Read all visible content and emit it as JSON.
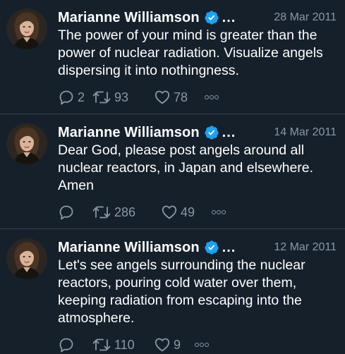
{
  "colors": {
    "background": "#15202b",
    "divider": "#38444d",
    "secondary_text": "#8899a6",
    "verified_blue": "#1da1f2"
  },
  "tweets": [
    {
      "author": "Marianne Williamson",
      "truncation": "...",
      "date": "28 Mar 2011",
      "text": "The power of your mind is greater than the power of nuclear radiation. Visualize angels dispersing it into nothingness.",
      "replies": "2",
      "retweets": "93",
      "likes": "78"
    },
    {
      "author": "Marianne Williamson",
      "truncation": "...",
      "date": "14 Mar 2011",
      "text": "Dear God, please post angels around all nuclear reactors, in Japan and elsewhere. Amen",
      "replies": "",
      "retweets": "286",
      "likes": "49"
    },
    {
      "author": "Marianne Williamson",
      "truncation": "...",
      "date": "12 Mar 2011",
      "text": "Let's see angels surrounding the nuclear reactors, pouring cold water over them, keeping radiation from escaping into the atmosphere.",
      "replies": "",
      "retweets": "110",
      "likes": "9"
    }
  ],
  "icons": {
    "avatar": "profile-photo",
    "verified": "verified-badge-icon",
    "reply": "reply-icon",
    "retweet": "retweet-icon",
    "like": "heart-icon",
    "more": "more-dots-icon"
  }
}
